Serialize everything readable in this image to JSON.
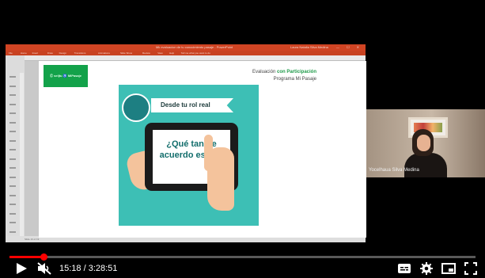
{
  "ppt": {
    "window_title": "Mk evaluacion de tu conocimiento pasaje - PowerPoint",
    "user": "Laura Natalia Silva Medina",
    "tabs": [
      "File",
      "Home",
      "Insert",
      "Draw",
      "Design",
      "Transitions",
      "Animations",
      "Slide Show",
      "Review",
      "View",
      "Help",
      "Tell me what you want to do"
    ],
    "status": "Slide 13 of 19"
  },
  "slide": {
    "logo_text": "Ⓒ sel|tu ♿ MiPasaje",
    "eval_line1_prefix": "Evaluación ",
    "eval_line1_highlight": "con Participación",
    "eval_line2": "Programa Mi Pasaje",
    "banner": "Desde tu rol real",
    "question": "¿Qué tan de acuerdo estás?",
    "colors": {
      "card": "#3dbfb5",
      "accent_green": "#13a24a",
      "question_text": "#136e6c"
    }
  },
  "webcam": {
    "name": "Yocelhaua Silva Medina"
  },
  "player": {
    "time": "15:18 / 3:28:51",
    "progress_fraction": 0.0733,
    "icons": [
      "play-icon",
      "muted-volume-icon",
      "subtitles-icon",
      "settings-gear-icon",
      "miniplayer-icon",
      "fullscreen-icon"
    ]
  }
}
